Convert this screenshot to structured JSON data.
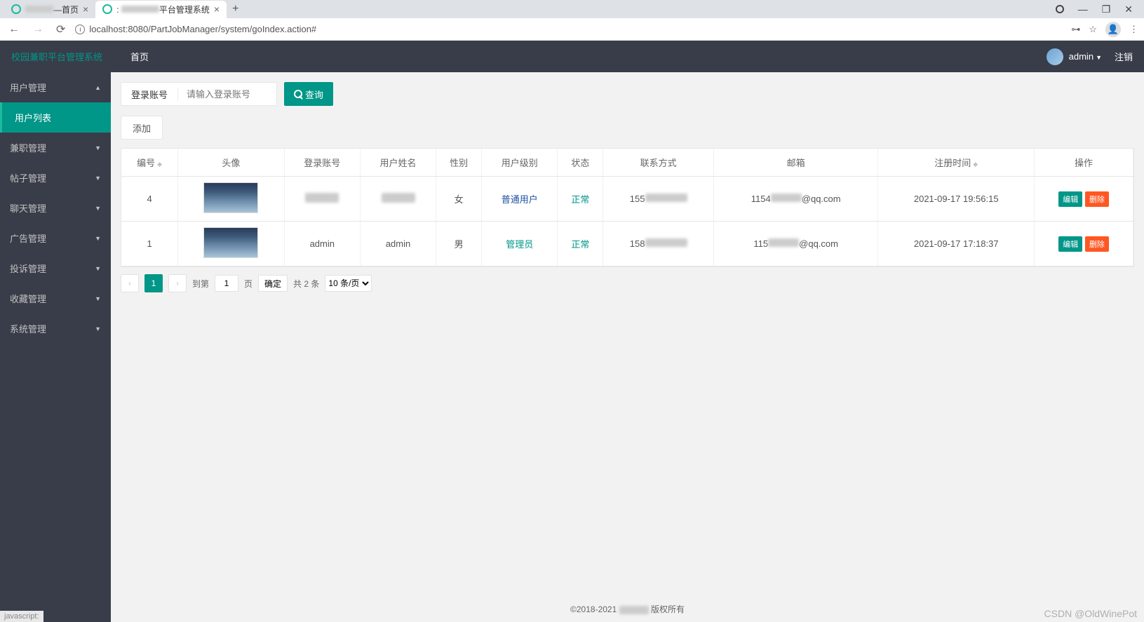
{
  "browser": {
    "tabs": [
      {
        "title": "首页",
        "active": false
      },
      {
        "title": "平台管理系统",
        "active": true
      }
    ],
    "url": "localhost:8080/PartJobManager/system/goIndex.action#"
  },
  "topbar": {
    "brand": "校园兼职平台管理系统",
    "home": "首页",
    "username": "admin",
    "logout": "注销"
  },
  "sidebar": {
    "items": [
      {
        "label": "用户管理",
        "expanded": true
      },
      {
        "label": "用户列表",
        "sub": true,
        "active": true
      },
      {
        "label": "兼职管理"
      },
      {
        "label": "帖子管理"
      },
      {
        "label": "聊天管理"
      },
      {
        "label": "广告管理"
      },
      {
        "label": "投诉管理"
      },
      {
        "label": "收藏管理"
      },
      {
        "label": "系统管理"
      }
    ]
  },
  "search": {
    "label": "登录账号",
    "placeholder": "请输入登录账号",
    "button": "查询"
  },
  "add_button": "添加",
  "table": {
    "headers": [
      "编号",
      "头像",
      "登录账号",
      "用户姓名",
      "性别",
      "用户级别",
      "状态",
      "联系方式",
      "邮箱",
      "注册时间",
      "操作"
    ],
    "rows": [
      {
        "id": "4",
        "account": "████",
        "name": "████",
        "gender": "女",
        "level": "普通用户",
        "level_class": "link-user",
        "status": "正常",
        "phone": "155████████",
        "email": "1154████@qq.com",
        "regtime": "2021-09-17 19:56:15"
      },
      {
        "id": "1",
        "account": "admin",
        "name": "admin",
        "gender": "男",
        "level": "管理员",
        "level_class": "link-admin",
        "status": "正常",
        "phone": "158████████",
        "email": "115████@qq.com",
        "regtime": "2021-09-17 17:18:37"
      }
    ],
    "actions": {
      "edit": "编辑",
      "delete": "删除"
    }
  },
  "pagination": {
    "current": "1",
    "goto_prefix": "到第",
    "goto_input": "1",
    "goto_suffix": "页",
    "confirm": "确定",
    "total": "共 2 条",
    "per_page": "10 条/页"
  },
  "footer": {
    "copyright_prefix": "©2018-2021",
    "copyright_suffix": "版权所有"
  },
  "status_bar": "javascript:",
  "watermark": "CSDN @OldWinePot"
}
